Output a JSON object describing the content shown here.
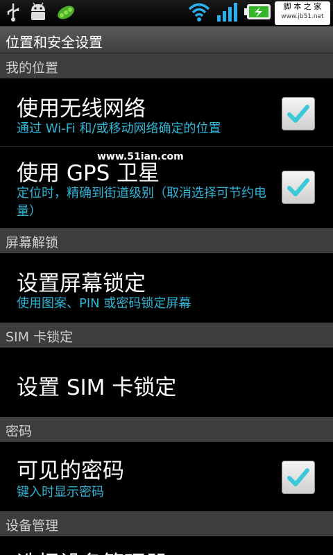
{
  "watermark": {
    "line1": "脚 本 之 家",
    "line2": "www.jb51.net"
  },
  "overlay": {
    "text": "www.51ian.com"
  },
  "header": {
    "title": "位置和安全设置"
  },
  "sections": {
    "location": "我的位置",
    "screen_unlock": "屏幕解锁",
    "sim_lock": "SIM 卡锁定",
    "password": "密码",
    "device_admin": "设备管理"
  },
  "items": {
    "wireless": {
      "title": "使用无线网络",
      "summary": "通过 Wi-Fi 和/或移动网络确定的位置",
      "checked": true
    },
    "gps": {
      "title": "使用 GPS 卫星",
      "summary": "定位时，精确到街道级别（取消选择可节约电量）",
      "checked": true
    },
    "screen_lock": {
      "title": "设置屏幕锁定",
      "summary": "使用图案、PIN 或密码锁定屏幕"
    },
    "sim_lock": {
      "title": "设置 SIM 卡锁定"
    },
    "visible_password": {
      "title": "可见的密码",
      "summary": "键入时显示密码",
      "checked": true
    },
    "device_admin": {
      "title": "选择设备管理器"
    }
  },
  "colors": {
    "accent": "#2fb6d6",
    "check": "#3cc8d8",
    "section_bg": "#3d3d3d"
  }
}
